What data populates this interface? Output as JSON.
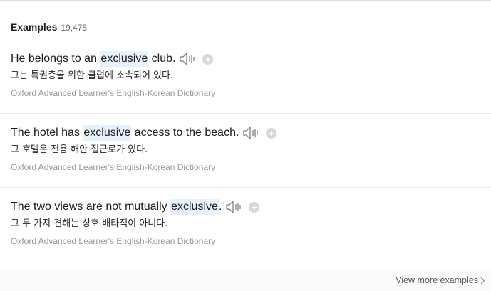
{
  "header": {
    "title": "Examples",
    "count": "19,475"
  },
  "examples": [
    {
      "before": "He belongs to an ",
      "highlight": "exclusive",
      "after": " club.",
      "translation": "그는 특권층을 위한 클럽에 소속되어 있다.",
      "source": "Oxford Advanced Learner's English-Korean Dictionary"
    },
    {
      "before": "The hotel has ",
      "highlight": "exclusive",
      "after": " access to the beach.",
      "translation": "그 호텔은 전용 해안 접근로가 있다.",
      "source": "Oxford Advanced Learner's English-Korean Dictionary"
    },
    {
      "before": "The two views are not mutually ",
      "highlight": "exclusive",
      "after": ".",
      "translation": "그 두 가지 견해는 상호 배타적이 아니다.",
      "source": "Oxford Advanced Learner's English-Korean Dictionary"
    }
  ],
  "icons": {
    "speaker": "speaker-icon",
    "add": "plus-icon",
    "chevron": "chevron-right-icon"
  },
  "add_symbol": "+",
  "footer": {
    "view_more_label": "View more examples"
  },
  "colors": {
    "highlight_bg": "#e8f2ff",
    "source_text": "#999999",
    "add_button": "#d7d7d7"
  }
}
